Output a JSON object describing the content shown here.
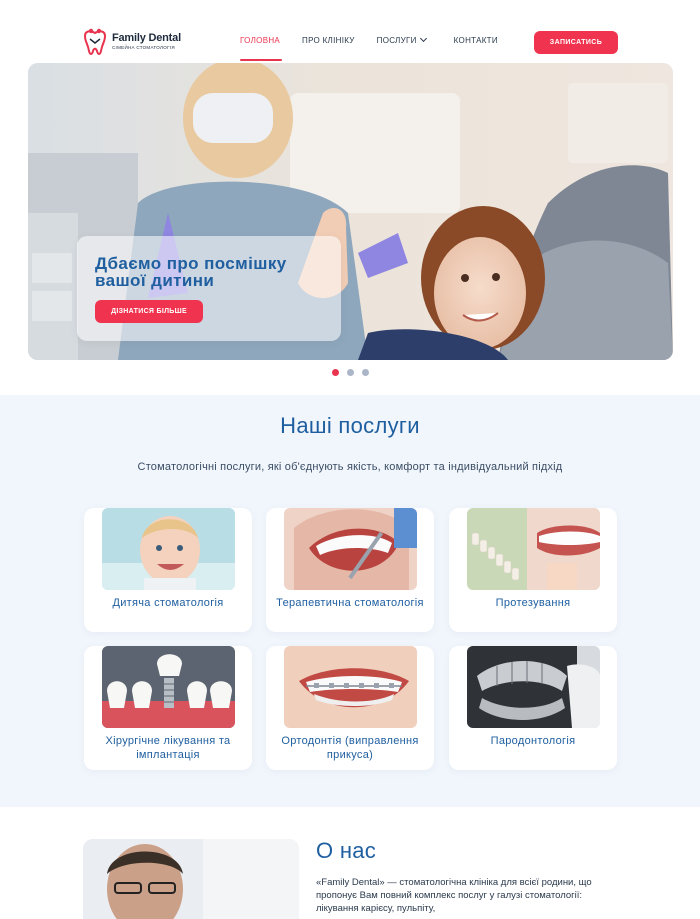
{
  "brand": {
    "name": "Family Dental",
    "tagline": "СІМЕЙНА СТОМАТОЛОГІЯ",
    "color": "#e8344e"
  },
  "nav": {
    "items": [
      {
        "label": "ГОЛОВНА"
      },
      {
        "label": "ПРО КЛІНІКУ"
      },
      {
        "label": "ПОСЛУГИ"
      },
      {
        "label": "КОНТАКТИ"
      }
    ],
    "cta": "ЗАПИСАТИСЬ"
  },
  "hero": {
    "title": "Дбаємо про посмішку вашої дитини",
    "button": "ДІЗНАТИСЯ БІЛЬШЕ",
    "slides": 3,
    "active_slide": 1
  },
  "services": {
    "title": "Наші послуги",
    "subtitle": "Стоматологічні послуги, які об'єднують якість, комфорт та індивідуальний підхід",
    "items": [
      {
        "label": "Дитяча стоматологія"
      },
      {
        "label": "Терапевтична стоматологія"
      },
      {
        "label": "Протезування"
      },
      {
        "label": "Хірургічне лікування та імплантація"
      },
      {
        "label": "Ортодонтія (виправлення прикуса)"
      },
      {
        "label": "Пародонтологія"
      }
    ]
  },
  "about": {
    "title": "О нас",
    "text": "«Family Dental» — стоматологічна клініка для всієї родини, що пропонує Вам повний комплекс послуг у галузі стоматології: лікування карієсу, пульпіту,"
  },
  "colors": {
    "primary": "#1f5fa0",
    "accent": "#f0344f",
    "section_bg": "#f1f6fc"
  }
}
